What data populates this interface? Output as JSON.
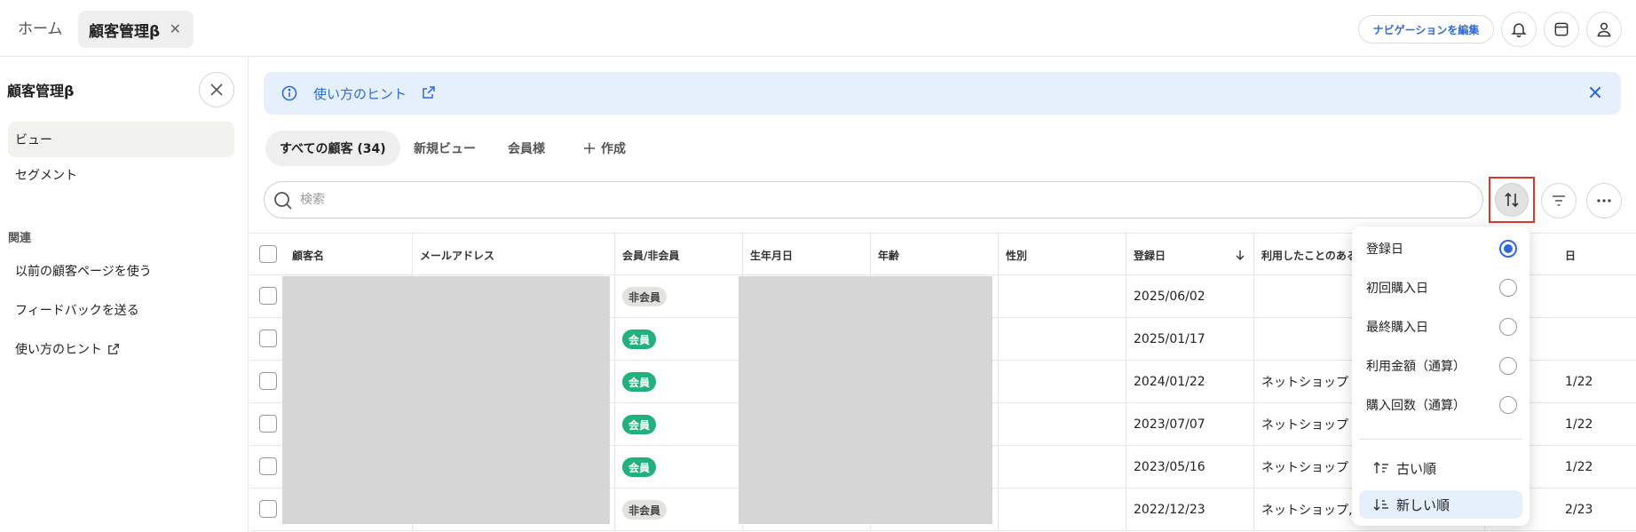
{
  "header": {
    "home_tab": "ホーム",
    "active_tab": "顧客管理β",
    "tab_close": "✕",
    "nav_edit": "ナビゲーションを編集"
  },
  "sidebar": {
    "title": "顧客管理β",
    "items": [
      {
        "label": "ビュー",
        "active": true
      },
      {
        "label": "セグメント",
        "active": false
      }
    ],
    "section_label": "関連",
    "related": [
      {
        "label": "以前の顧客ページを使う"
      },
      {
        "label": "フィードバックを送る"
      },
      {
        "label": "使い方のヒント"
      }
    ]
  },
  "hint_banner": {
    "text": "使い方のヒント"
  },
  "view_tabs": [
    {
      "label": "すべての顧客 (34)",
      "active": true
    },
    {
      "label": "新規ビュー",
      "active": false
    },
    {
      "label": "会員様",
      "active": false
    },
    {
      "label": "作成",
      "active": false
    }
  ],
  "search": {
    "placeholder": "検索",
    "value": ""
  },
  "table": {
    "columns": [
      "顧客名",
      "メールアドレス",
      "会員/非会員",
      "生年月日",
      "年齢",
      "性別",
      "登録日",
      "利用したことのある",
      "日"
    ],
    "rows": [
      {
        "membership": "非会員",
        "member": false,
        "registered": "2025/06/02",
        "used": "",
        "last": ""
      },
      {
        "membership": "会員",
        "member": true,
        "registered": "2025/01/17",
        "used": "",
        "last": ""
      },
      {
        "membership": "会員",
        "member": true,
        "registered": "2024/01/22",
        "used": "ネットショップ",
        "last": "1/22"
      },
      {
        "membership": "会員",
        "member": true,
        "registered": "2023/07/07",
        "used": "ネットショップ",
        "last": "1/22"
      },
      {
        "membership": "会員",
        "member": true,
        "registered": "2023/05/16",
        "used": "ネットショップ",
        "last": "1/22"
      },
      {
        "membership": "非会員",
        "member": false,
        "registered": "2022/12/23",
        "used": "ネットショップ,",
        "last": "2/23"
      }
    ]
  },
  "sort_menu": {
    "fields": [
      {
        "label": "登録日",
        "selected": true
      },
      {
        "label": "初回購入日",
        "selected": false
      },
      {
        "label": "最終購入日",
        "selected": false
      },
      {
        "label": "利用金額（通算）",
        "selected": false
      },
      {
        "label": "購入回数（通算）",
        "selected": false
      }
    ],
    "orders": [
      {
        "label": "古い順",
        "selected": false
      },
      {
        "label": "新しい順",
        "selected": true
      }
    ]
  },
  "colors": {
    "accent": "#2f6bd8",
    "member_badge": "#22b07d",
    "highlight": "#e0392b",
    "hint_bg": "#e6f0fd"
  }
}
